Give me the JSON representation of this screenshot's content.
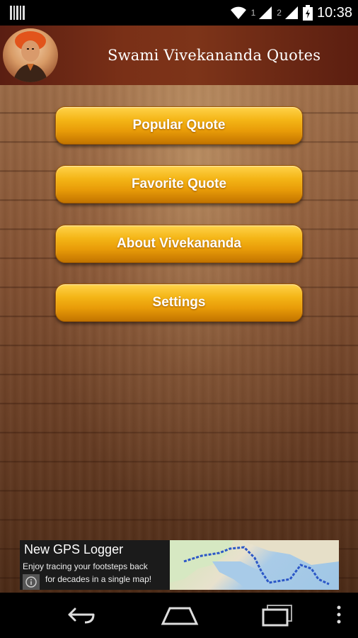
{
  "status_bar": {
    "time": "10:38",
    "sim1_label": "1",
    "sim2_label": "2",
    "icons": [
      "barcode-icon",
      "wifi-icon",
      "signal-icon",
      "signal-icon",
      "battery-icon"
    ]
  },
  "header": {
    "title": "Swami Vivekananda Quotes"
  },
  "menu": {
    "items": [
      {
        "label": "Popular Quote"
      },
      {
        "label": "Favorite Quote"
      },
      {
        "label": "About Vivekananda"
      },
      {
        "label": "Settings"
      }
    ]
  },
  "ad": {
    "title": "New GPS Logger",
    "line1": "Enjoy tracing your footsteps back",
    "line2": "for decades in a single map!"
  },
  "nav": {
    "icons": [
      "back-icon",
      "home-icon",
      "recents-icon",
      "overflow-menu-icon"
    ]
  },
  "colors": {
    "button_gold": "#f4b516",
    "header_brown": "#7a3017",
    "wood": "#845233"
  }
}
